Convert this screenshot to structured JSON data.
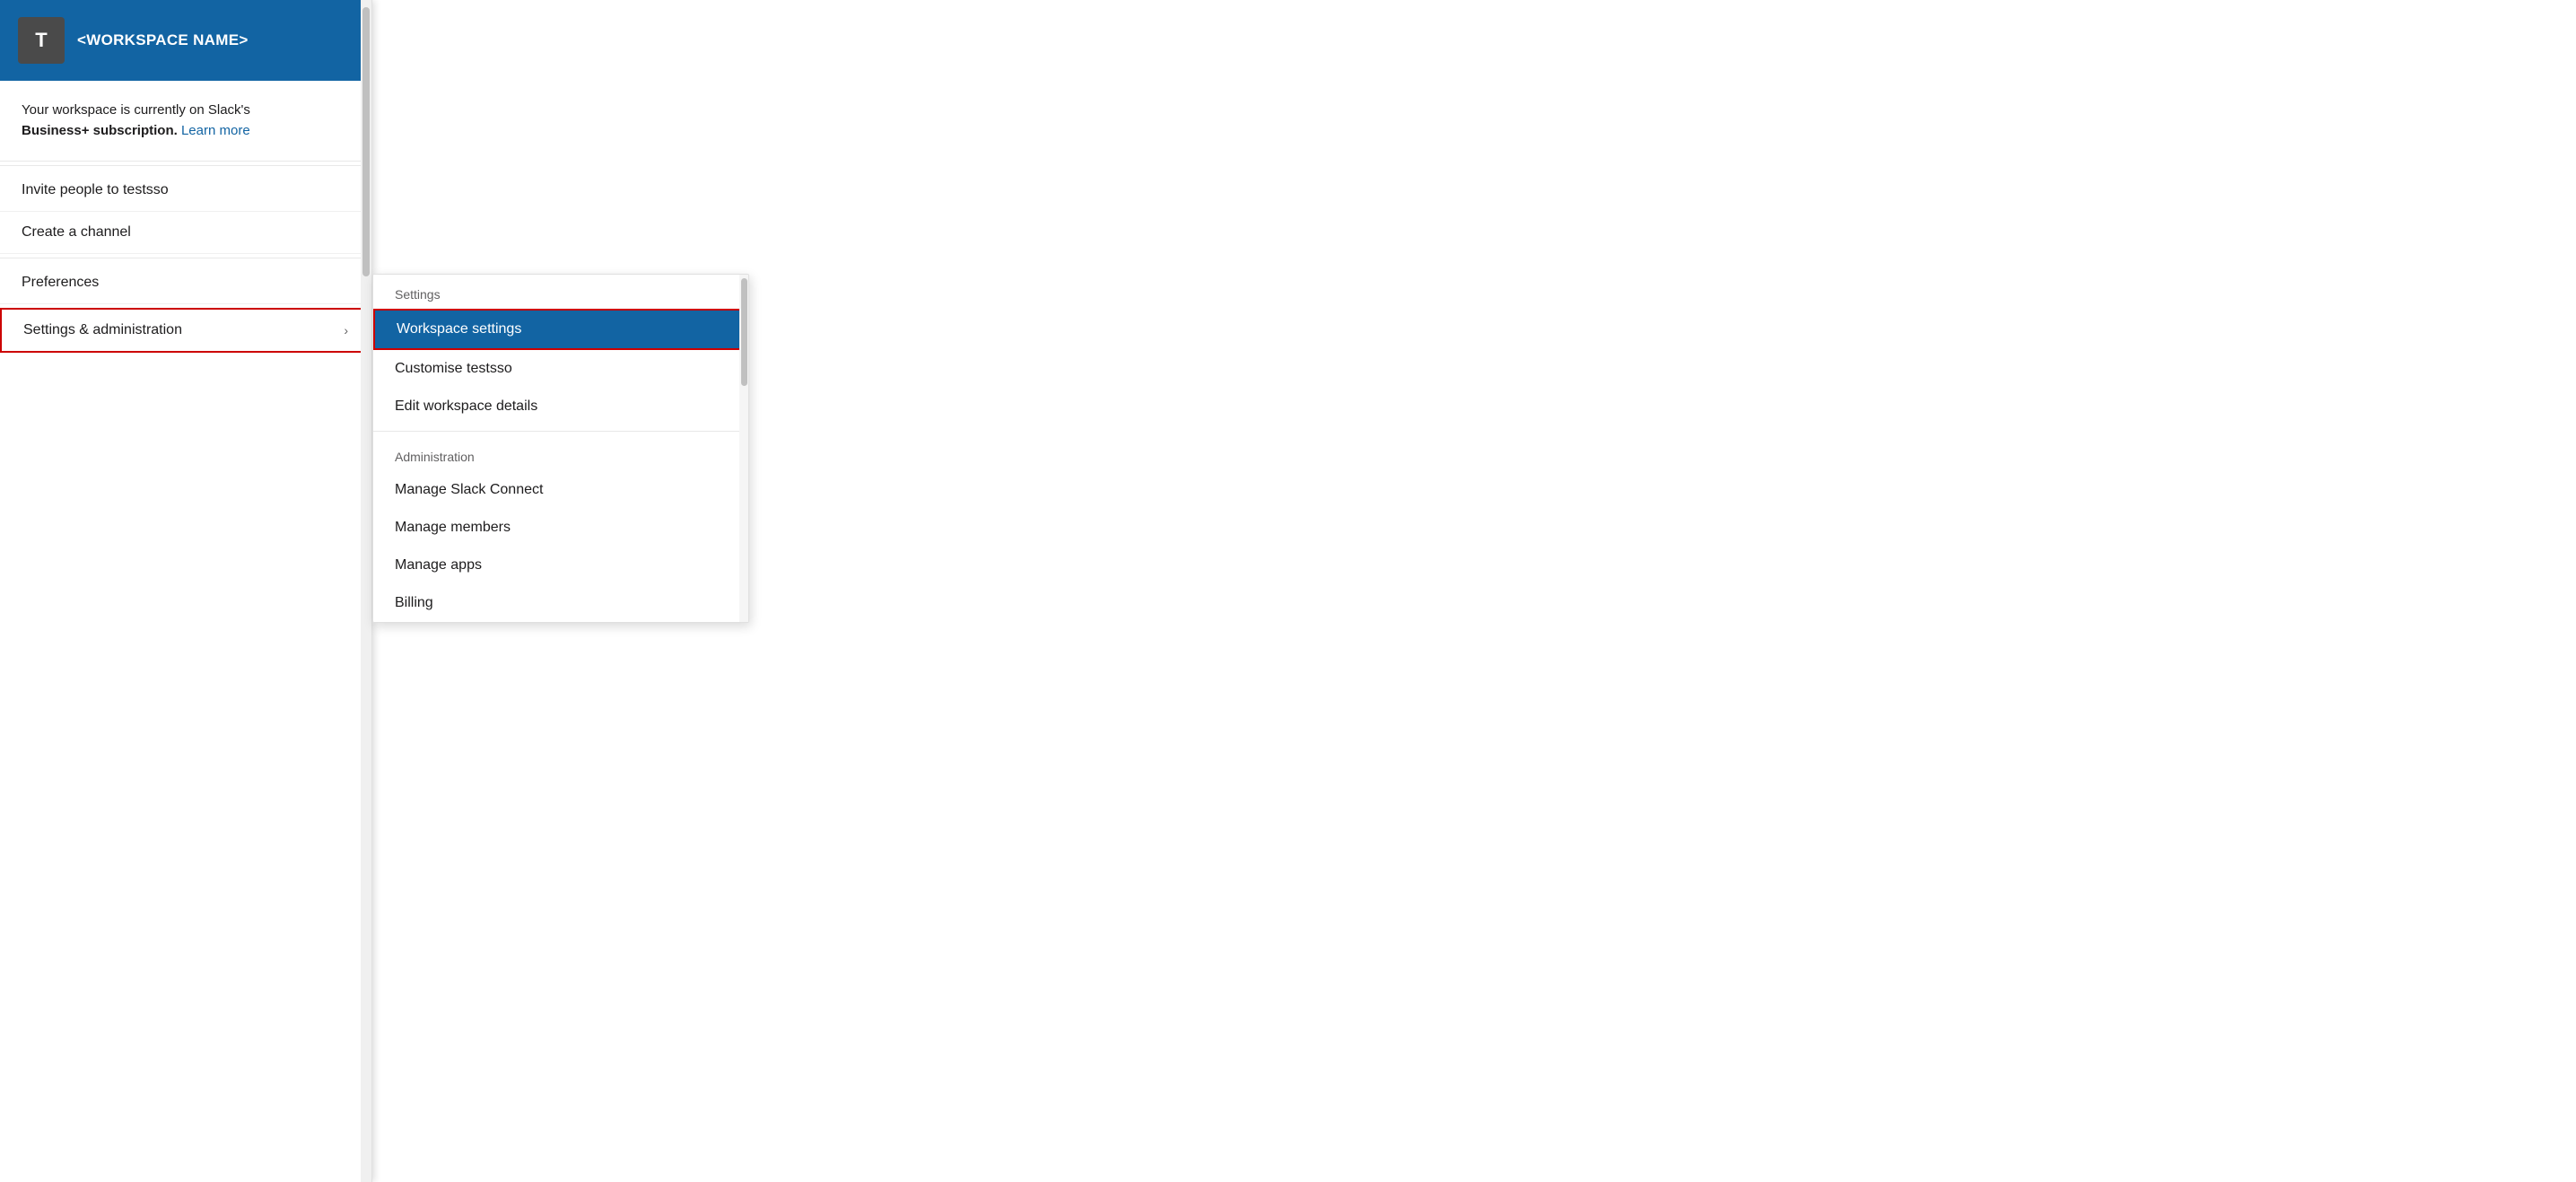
{
  "workspace": {
    "avatar_letter": "T",
    "name": "<WORKSPACE NAME>"
  },
  "subscription": {
    "text_prefix": "Your workspace is currently on Slack's",
    "bold_text": "Business+ subscription.",
    "link_text": "Learn more"
  },
  "primary_menu": {
    "items": [
      {
        "id": "invite",
        "label": "Invite people to testsso"
      },
      {
        "id": "create-channel",
        "label": "Create a channel"
      }
    ],
    "preferences_label": "Preferences",
    "settings_admin_label": "Settings & administration",
    "chevron": "›"
  },
  "submenu": {
    "settings_section_header": "Settings",
    "workspace_settings_label": "Workspace settings",
    "customise_label": "Customise testsso",
    "edit_workspace_label": "Edit workspace details",
    "administration_section_header": "Administration",
    "administration_items": [
      {
        "id": "manage-slack-connect",
        "label": "Manage Slack Connect"
      },
      {
        "id": "manage-members",
        "label": "Manage members"
      },
      {
        "id": "manage-apps",
        "label": "Manage apps"
      },
      {
        "id": "billing",
        "label": "Billing"
      }
    ]
  },
  "colors": {
    "primary_blue": "#1264a3",
    "active_item_bg": "#1264a3",
    "border_red": "#cc0000",
    "text_dark": "#1d1c1d",
    "text_muted": "#616061",
    "bg_white": "#ffffff"
  }
}
